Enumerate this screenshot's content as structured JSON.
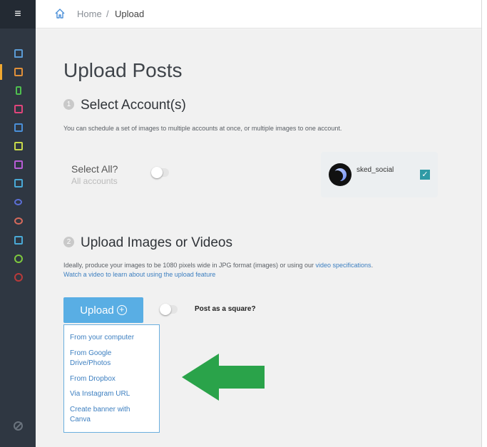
{
  "colors": {
    "sidebar": "#2f3742",
    "accent": "#59aee4",
    "link": "#3d7fc0",
    "checkbox": "#2f9aa5",
    "arrow": "#2aa34a"
  },
  "sidebar": {
    "menu_icon": "hamburger-icon",
    "icons": [
      "home-icon",
      "upload-icon",
      "phone-icon",
      "calendar-icon",
      "grid-icon",
      "edit-icon",
      "mail-icon",
      "inbox-icon",
      "users-icon",
      "database-icon",
      "user-icon",
      "settings-icon",
      "help-icon"
    ],
    "bottom_icon": "block-icon"
  },
  "breadcrumb": {
    "home": "Home",
    "separator": "/",
    "current": "Upload"
  },
  "page": {
    "title": "Upload Posts"
  },
  "select_accounts": {
    "step": "1",
    "title": "Select Account(s)",
    "description": "You can schedule a set of images to multiple accounts at once, or multiple images to one account.",
    "select_all_label": "Select All?",
    "all_accounts_label": "All accounts",
    "account": {
      "name": "sked_social",
      "checked": true
    }
  },
  "upload_section": {
    "step": "2",
    "title": "Upload Images or Videos",
    "description_1": "Ideally, produce your images to be 1080 pixels wide in JPG format (images) or using our ",
    "video_spec_link": "video specifications",
    "description_1_end": ".",
    "watch_video_link": "Watch a video to learn about using the upload feature",
    "upload_button": "Upload",
    "post_square_label": "Post as a square?",
    "menu_items": [
      "From your computer",
      "From Google Drive/Photos",
      "From Dropbox",
      "Via Instagram URL",
      "Create banner with Canva"
    ]
  }
}
